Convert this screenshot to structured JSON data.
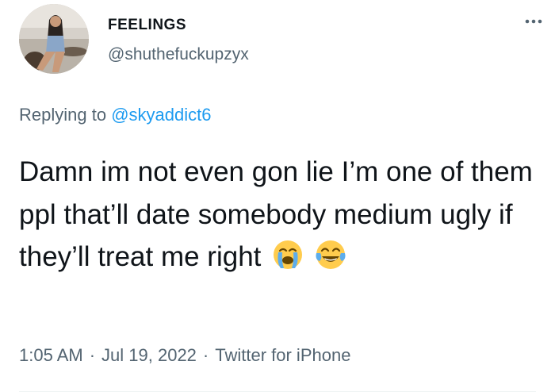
{
  "author": {
    "display_name": "FEELINGS",
    "handle": "@shuthefuckupzyx"
  },
  "reply": {
    "prefix": "Replying to",
    "mention": "@skyaddict6"
  },
  "tweet": {
    "text": "Damn im not even gon lie I’m one of them ppl that’ll date somebody medium ugly if they’ll treat me right",
    "emojis": [
      "loudly-crying-face",
      "face-with-tears-of-joy"
    ]
  },
  "meta": {
    "time": "1:05 AM",
    "date": "Jul 19, 2022",
    "source": "Twitter for iPhone",
    "separator": "·"
  },
  "colors": {
    "text": "#0f1419",
    "secondary": "#536471",
    "link": "#1d9bf0"
  },
  "icons": {
    "more": "more-horizontal-icon"
  }
}
